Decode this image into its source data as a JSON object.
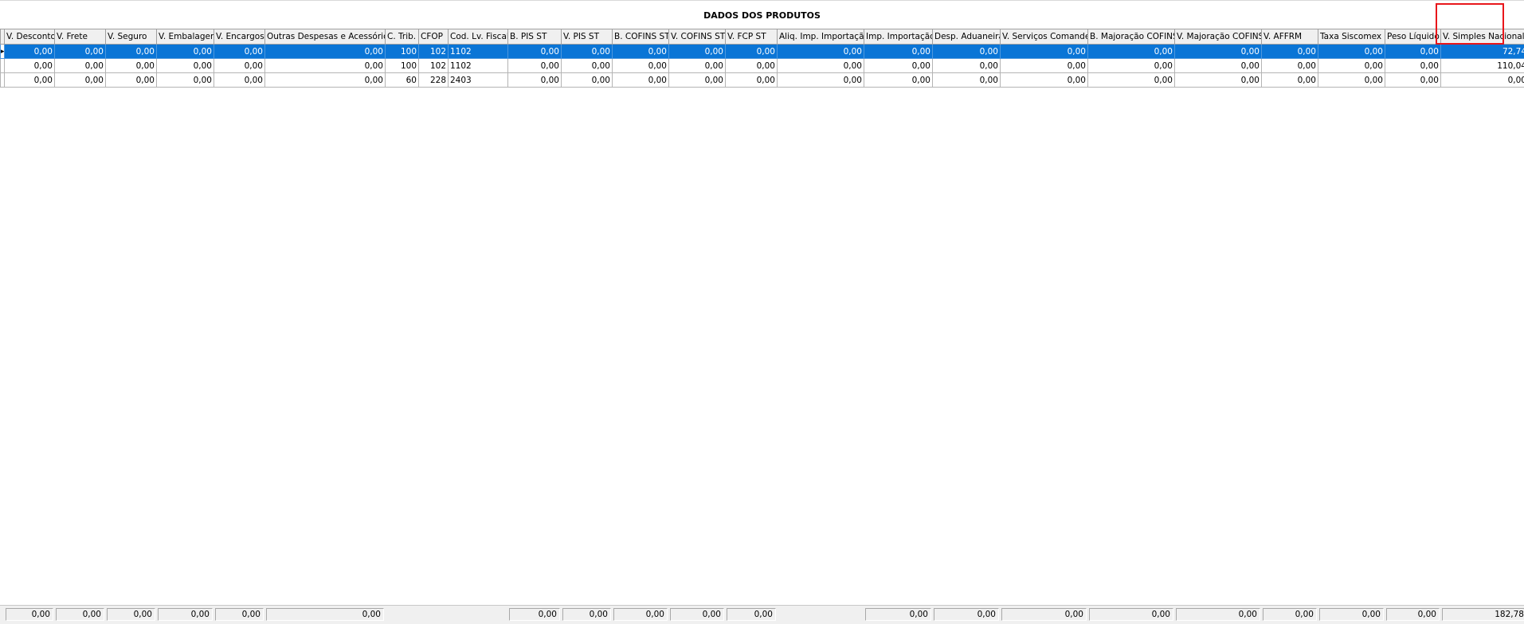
{
  "title": "DADOS DOS PRODUTOS",
  "columns": [
    "V. Desconto",
    "V. Frete",
    "V. Seguro",
    "V. Embalagem",
    "V. Encargos",
    "Outras Despesas e Acessórios",
    "C. Trib.",
    "CFOP",
    "Cod. Lv. Fiscal",
    "B. PIS ST",
    "V. PIS ST",
    "B. COFINS ST",
    "V. COFINS ST",
    "V. FCP ST",
    "Aliq. Imp. Importação",
    "Imp. Importação",
    "Desp. Aduaneira",
    "V. Serviços Comander",
    "B. Majoração COFINS",
    "V. Majoração COFINS",
    "V. AFFRM",
    "Taxa Siscomex",
    "Peso Líquido",
    "V. Simples Nacional"
  ],
  "rows": [
    [
      "0,00",
      "0,00",
      "0,00",
      "0,00",
      "0,00",
      "0,00",
      "100",
      "102",
      "1102",
      "0,00",
      "0,00",
      "0,00",
      "0,00",
      "0,00",
      "0,00",
      "0,00",
      "0,00",
      "0,00",
      "0,00",
      "0,00",
      "0,00",
      "0,00",
      "0,00",
      "72,74"
    ],
    [
      "0,00",
      "0,00",
      "0,00",
      "0,00",
      "0,00",
      "0,00",
      "100",
      "102",
      "1102",
      "0,00",
      "0,00",
      "0,00",
      "0,00",
      "0,00",
      "0,00",
      "0,00",
      "0,00",
      "0,00",
      "0,00",
      "0,00",
      "0,00",
      "0,00",
      "0,00",
      "110,04"
    ],
    [
      "0,00",
      "0,00",
      "0,00",
      "0,00",
      "0,00",
      "0,00",
      "60",
      "228",
      "2403",
      "0,00",
      "0,00",
      "0,00",
      "0,00",
      "0,00",
      "0,00",
      "0,00",
      "0,00",
      "0,00",
      "0,00",
      "0,00",
      "0,00",
      "0,00",
      "0,00",
      "0,00"
    ]
  ],
  "selected_row": 0,
  "row_indicator_icon": "current-row-arrow-icon",
  "totals": [
    "0,00",
    "0,00",
    "0,00",
    "0,00",
    "0,00",
    "0,00",
    "",
    "",
    "",
    "0,00",
    "0,00",
    "0,00",
    "0,00",
    "0,00",
    "",
    "0,00",
    "0,00",
    "0,00",
    "0,00",
    "0,00",
    "0,00",
    "0,00",
    "0,00",
    "182,78"
  ],
  "colors": {
    "selection": "#0a75d6",
    "highlight": "#e8161b",
    "header_bg": "#f0f0f0"
  }
}
